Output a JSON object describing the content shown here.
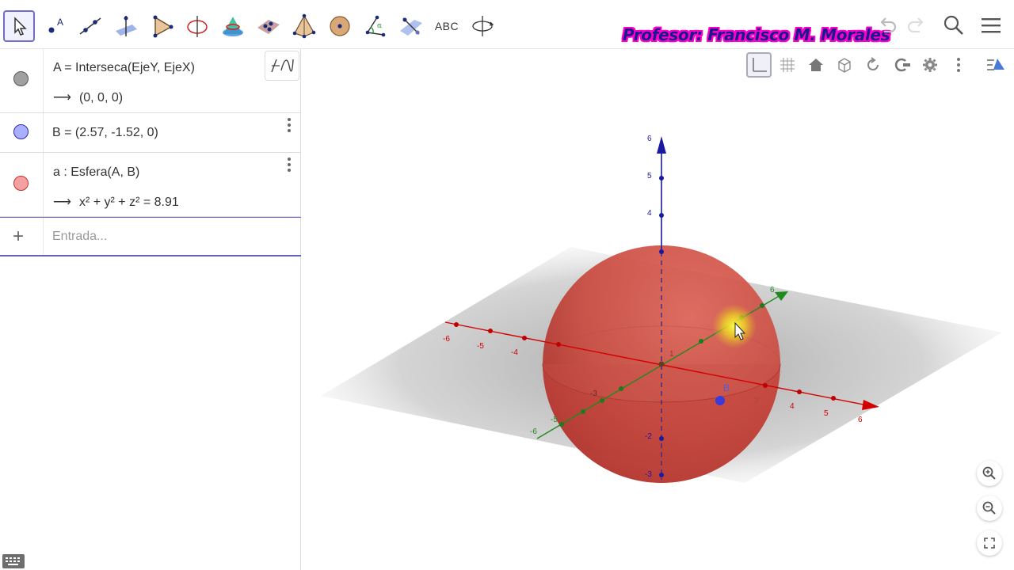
{
  "toolbar": {
    "tools": [
      {
        "name": "move-tool",
        "label": "Move"
      },
      {
        "name": "point-tool",
        "label": "Point"
      },
      {
        "name": "line-tool",
        "label": "Line"
      },
      {
        "name": "perpendicular-tool",
        "label": "Perpendicular Line"
      },
      {
        "name": "polygon-tool",
        "label": "Polygon"
      },
      {
        "name": "circle-axis-tool",
        "label": "Circle with Axis"
      },
      {
        "name": "intersect-surfaces-tool",
        "label": "Intersect Two Surfaces"
      },
      {
        "name": "plane-tool",
        "label": "Plane through 3 points"
      },
      {
        "name": "pyramid-tool",
        "label": "Pyramid"
      },
      {
        "name": "sphere-tool",
        "label": "Sphere"
      },
      {
        "name": "angle-tool",
        "label": "Angle"
      },
      {
        "name": "reflect-tool",
        "label": "Reflect"
      },
      {
        "name": "text-tool",
        "label": "ABC"
      },
      {
        "name": "rotate-view-tool",
        "label": "Rotate 3D view"
      }
    ],
    "text_tool_label": "ABC",
    "banner": "Profesor: Francisco M. Morales"
  },
  "algebra": {
    "items": [
      {
        "definition": "A = Interseca(EjeY, EjeX)",
        "value": "(0, 0, 0)",
        "color": "#a0a0a0"
      },
      {
        "definition": "B = (2.57, -1.52, 0)",
        "color": "#8c8cff"
      },
      {
        "definition": "a : Esfera(A, B)",
        "value": "x² + y² + z² = 8.91",
        "color": "#ff7a7a"
      }
    ],
    "input_placeholder": "Entrada...",
    "arrow": "⟶"
  },
  "graphics": {
    "point_B_label": "B",
    "z_ticks": [
      "6",
      "5",
      "4",
      "-2",
      "-3"
    ],
    "x_ticks_neg": [
      "-6",
      "-5",
      "-4"
    ],
    "x_ticks_pos": [
      "4",
      "5",
      "6"
    ],
    "y_ticks": [
      "-6",
      "-5",
      "6"
    ],
    "inner_labels": [
      "-3",
      "1",
      "3"
    ],
    "sphere_color": "#d84a40",
    "x_axis_color": "#d40000",
    "y_axis_color": "#1f8a1f",
    "z_axis_color": "#1a1aa0"
  }
}
